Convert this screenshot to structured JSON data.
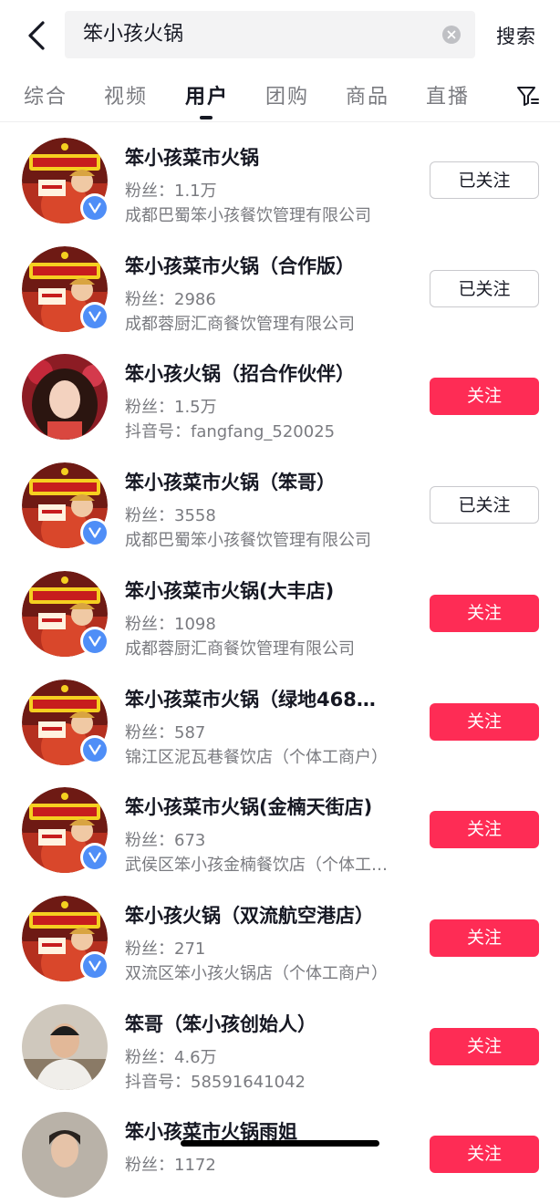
{
  "search": {
    "query": "笨小孩火锅",
    "button_label": "搜索"
  },
  "tabs": [
    {
      "label": "综合"
    },
    {
      "label": "视频"
    },
    {
      "label": "用户"
    },
    {
      "label": "团购"
    },
    {
      "label": "商品"
    },
    {
      "label": "直播"
    }
  ],
  "active_tab": "用户",
  "results": [
    {
      "name": "笨小孩菜市火锅",
      "fans": "粉丝：1.1万",
      "desc": "成都巴蜀笨小孩餐饮管理有限公司",
      "button": "已关注",
      "followed": true,
      "verified": true,
      "avatar": "brand-logo"
    },
    {
      "name": "笨小孩菜市火锅（合作版）",
      "fans": "粉丝：2986",
      "desc": "成都蓉厨汇商餐饮管理有限公司",
      "button": "已关注",
      "followed": true,
      "verified": true,
      "avatar": "brand-logo"
    },
    {
      "name": "笨小孩火锅（招合作伙伴）",
      "fans": "粉丝：1.5万",
      "desc": "抖音号：fangfang_520025",
      "button": "关注",
      "followed": false,
      "verified": false,
      "avatar": "woman-photo"
    },
    {
      "name": "笨小孩菜市火锅（笨哥）",
      "fans": "粉丝：3558",
      "desc": "成都巴蜀笨小孩餐饮管理有限公司",
      "button": "已关注",
      "followed": true,
      "verified": true,
      "avatar": "brand-logo"
    },
    {
      "name": "笨小孩菜市火锅(大丰店)",
      "fans": "粉丝：1098",
      "desc": "成都蓉厨汇商餐饮管理有限公司",
      "button": "关注",
      "followed": false,
      "verified": true,
      "avatar": "brand-logo"
    },
    {
      "name": "笨小孩菜市火锅（绿地468…",
      "fans": "粉丝：587",
      "desc": "锦江区泥瓦巷餐饮店（个体工商户）",
      "button": "关注",
      "followed": false,
      "verified": true,
      "avatar": "brand-logo"
    },
    {
      "name": "笨小孩菜市火锅(金楠天街店)",
      "fans": "粉丝：673",
      "desc": "武侯区笨小孩金楠餐饮店（个体工…",
      "button": "关注",
      "followed": false,
      "verified": true,
      "avatar": "brand-logo"
    },
    {
      "name": "笨小孩火锅（双流航空港店）",
      "fans": "粉丝：271",
      "desc": "双流区笨小孩火锅店（个体工商户）",
      "button": "关注",
      "followed": false,
      "verified": true,
      "avatar": "brand-logo"
    },
    {
      "name": "笨哥（笨小孩创始人）",
      "fans": "粉丝：4.6万",
      "desc": "抖音号：58591641042",
      "button": "关注",
      "followed": false,
      "verified": false,
      "avatar": "man-photo"
    },
    {
      "name": "笨小孩菜市火锅雨姐",
      "fans": "粉丝：1172",
      "desc": "",
      "button": "关注",
      "followed": false,
      "verified": false,
      "avatar": "woman-photo-2"
    }
  ],
  "colors": {
    "accent": "#fe2c55",
    "verified": "#4f8ef7",
    "text_primary": "#161823",
    "text_secondary": "#7a7b80"
  }
}
